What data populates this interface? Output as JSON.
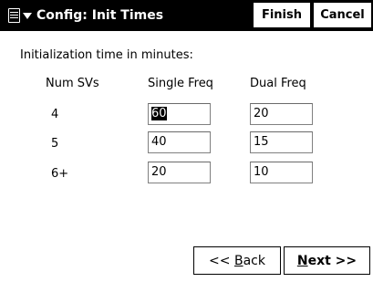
{
  "window": {
    "title": "Config: Init Times",
    "finish_label": "Finish",
    "cancel_label": "Cancel"
  },
  "content": {
    "section_label": "Initialization time in minutes:",
    "headers": {
      "num_svs": "Num SVs",
      "single_freq": "Single Freq",
      "dual_freq": "Dual Freq"
    },
    "rows": [
      {
        "num_svs": "4",
        "single_freq": "60",
        "dual_freq": "20"
      },
      {
        "num_svs": "5",
        "single_freq": "40",
        "dual_freq": "15"
      },
      {
        "num_svs": "6+",
        "single_freq": "20",
        "dual_freq": "10"
      }
    ]
  },
  "buttons": {
    "back": {
      "prefix": "<< ",
      "mnemonic": "B",
      "rest": "ack"
    },
    "next": {
      "mnemonic": "N",
      "rest": "ext >>"
    }
  },
  "icons": {
    "menu": "start-menu-icon",
    "caret": "dropdown-caret-icon"
  }
}
